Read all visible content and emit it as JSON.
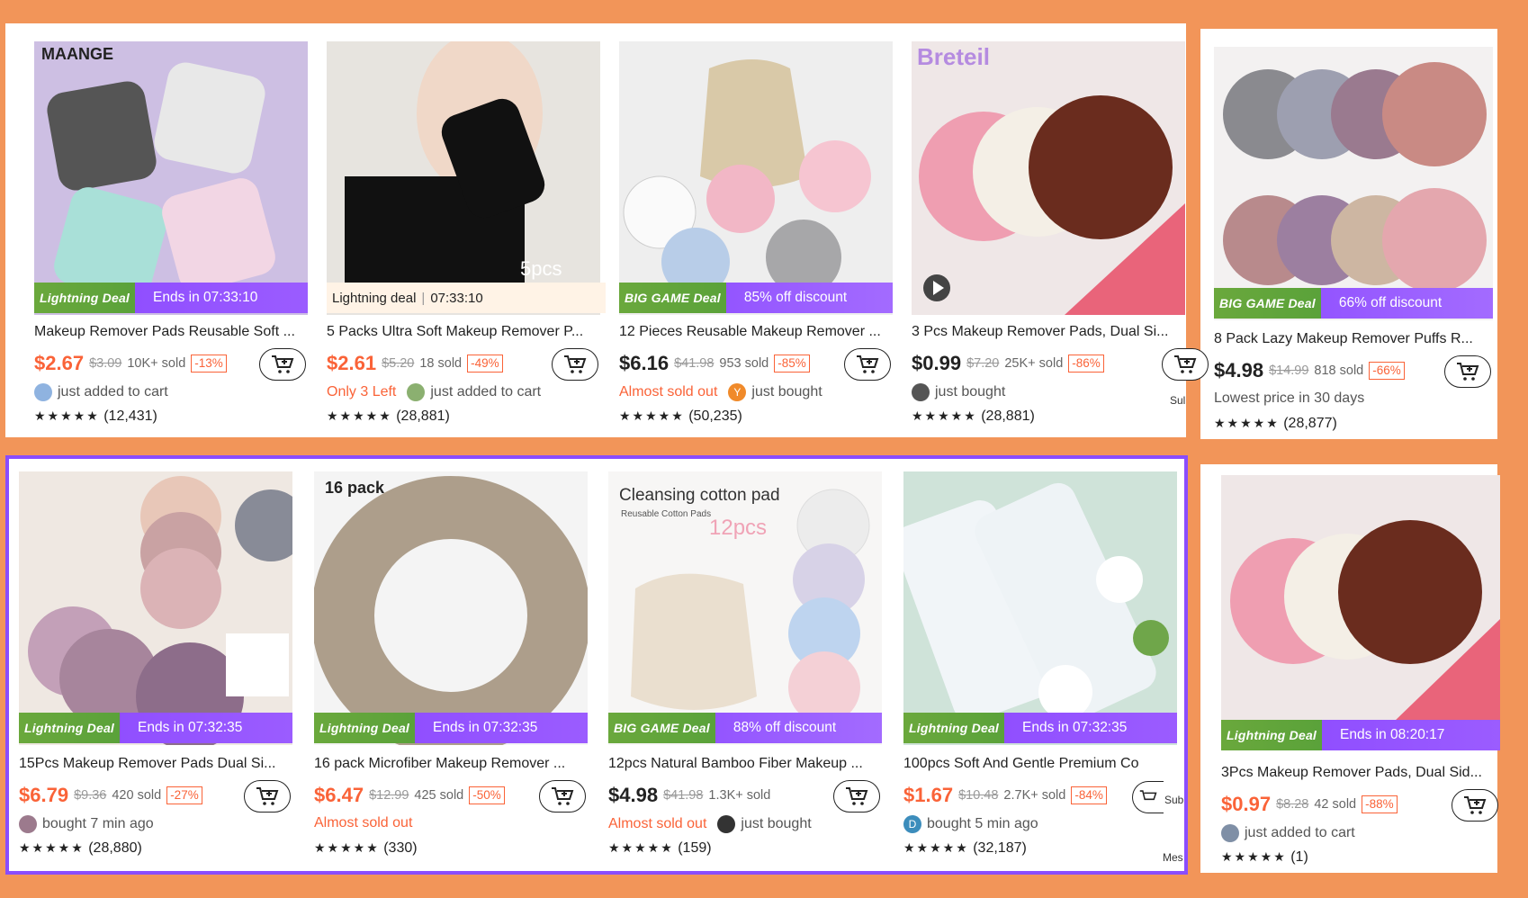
{
  "rows": [
    {
      "cards": [
        {
          "title": "Makeup Remover Pads Reusable Soft ...",
          "price": "$2.67",
          "old_price": "$3.09",
          "sold": "10K+ sold",
          "discount": "-13%",
          "banner": {
            "type": "lightning",
            "tag": "Lightning Deal",
            "text": "Ends in 07:33:10"
          },
          "brand_watermark": "MAANGE",
          "info_left": "",
          "info_right": "just added to cart",
          "stars": "★★★★★",
          "reviews": "(12,431)"
        },
        {
          "title": "5 Packs Ultra Soft Makeup Remover P...",
          "price": "$2.61",
          "old_price": "$5.20",
          "sold": "18 sold",
          "discount": "-49%",
          "banner": {
            "type": "plain",
            "tag": "Lightning deal",
            "text": "07:33:10"
          },
          "image_text": "5pcs",
          "info_left": "Only 3 Left",
          "info_right": "just added to cart",
          "stars": "★★★★★",
          "reviews": "(28,881)"
        },
        {
          "title": "12 Pieces Reusable Makeup Remover ...",
          "price": "$6.16",
          "old_price": "$41.98",
          "sold": "953 sold",
          "discount": "-85%",
          "banner": {
            "type": "big",
            "tag": "BIG GAME Deal",
            "text": "85% off discount"
          },
          "info_left": "Almost sold out",
          "info_right": "just bought",
          "avatar_letter": "Y",
          "stars": "★★★★★",
          "reviews": "(50,235)"
        },
        {
          "title": "3 Pcs Makeup Remover Pads, Dual Si...",
          "price": "$0.99",
          "old_price": "$7.20",
          "sold": "25K+ sold",
          "discount": "-86%",
          "banner": null,
          "brand_watermark": "Breteil",
          "info_left": "",
          "info_right": "just bought",
          "stars": "★★★★★",
          "reviews": "(28,881)"
        }
      ]
    },
    {
      "cards": [
        {
          "title": "15Pcs Makeup Remover Pads Dual Si...",
          "price": "$6.79",
          "old_price": "$9.36",
          "sold": "420 sold",
          "discount": "-27%",
          "banner": {
            "type": "lightning",
            "tag": "Lightning Deal",
            "text": "Ends in 07:32:35"
          },
          "info_left": "",
          "info_right": "bought 7 min ago",
          "stars": "★★★★★",
          "reviews": "(28,880)"
        },
        {
          "title": "16 pack Microfiber Makeup Remover ...",
          "price": "$6.47",
          "old_price": "$12.99",
          "sold": "425 sold",
          "discount": "-50%",
          "banner": {
            "type": "lightning",
            "tag": "Lightning Deal",
            "text": "Ends in 07:32:35"
          },
          "image_text": "16 pack",
          "info_left": "Almost sold out",
          "info_right": "",
          "stars": "★★★★★",
          "reviews": "(330)"
        },
        {
          "title": "12pcs Natural Bamboo Fiber Makeup ...",
          "price": "$4.98",
          "old_price": "$41.98",
          "sold": "1.3K+ sold",
          "discount": "",
          "banner": {
            "type": "big",
            "tag": "BIG GAME Deal",
            "text": "88% off discount"
          },
          "image_text": "Cleansing cotton pad",
          "image_subtext": "Reusable Cotton Pads",
          "image_count": "12pcs",
          "info_left": "Almost sold out",
          "info_right": "just bought",
          "stars": "★★★★★",
          "reviews": "(159)"
        },
        {
          "title": "100pcs Soft And Gentle Premium Co",
          "price": "$1.67",
          "old_price": "$10.48",
          "sold": "2.7K+ sold",
          "discount": "-84%",
          "banner": {
            "type": "lightning",
            "tag": "Lightning Deal",
            "text": "Ends in 07:32:35"
          },
          "info_left": "",
          "info_right": "bought 5 min ago",
          "avatar_letter": "D",
          "stars": "★★★★★",
          "reviews": "(32,187)"
        }
      ]
    }
  ],
  "side": [
    {
      "title": "8 Pack Lazy Makeup Remover Puffs R...",
      "price": "$4.98",
      "old_price": "$14.99",
      "sold": "818 sold",
      "discount": "-66%",
      "banner": {
        "type": "big",
        "tag": "BIG GAME Deal",
        "text": "66% off discount"
      },
      "info_left": "Lowest price in 30 days",
      "info_right": "",
      "stars": "★★★★★",
      "reviews": "(28,877)"
    },
    {
      "title": "3Pcs Makeup Remover Pads, Dual Sid...",
      "price": "$0.97",
      "old_price": "$8.28",
      "sold": "42 sold",
      "discount": "-88%",
      "banner": {
        "type": "lightning",
        "tag": "Lightning Deal",
        "text": "Ends in 08:20:17"
      },
      "info_left": "",
      "info_right": "just added to cart",
      "stars": "★★★★★",
      "reviews": "(1)"
    }
  ],
  "scraps": {
    "top": "Sul",
    "mid": "Sub",
    "bottom": "Mes"
  },
  "colors": {
    "accent": "#fa6338",
    "deal_purple": "#8a47ff",
    "page_bg": "#f29559",
    "highlight": "#8a4dff"
  }
}
